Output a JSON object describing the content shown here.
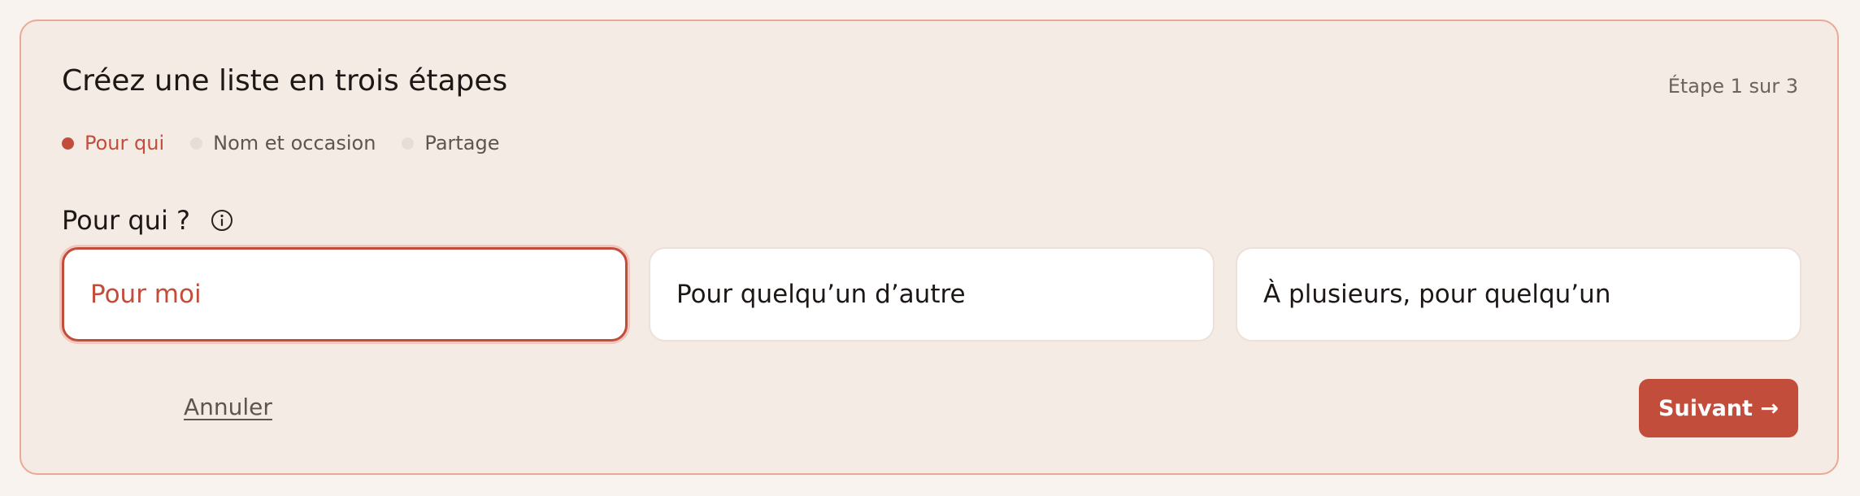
{
  "wizard": {
    "title": "Créez une liste en trois étapes",
    "step_counter": "Étape 1 sur 3",
    "steps": [
      {
        "label": "Pour qui"
      },
      {
        "label": "Nom et occasion"
      },
      {
        "label": "Partage"
      }
    ],
    "question": {
      "label": "Pour qui ?",
      "info_icon": "info-circle-icon"
    },
    "options": [
      {
        "label": "Pour moi"
      },
      {
        "label": "Pour quelqu’un d’autre"
      },
      {
        "label": "À plusieurs, pour quelqu’un"
      }
    ],
    "cancel_label": "Annuler",
    "next_label": "Suivant →"
  },
  "colors": {
    "accent": "#c24d3b",
    "card_background": "#f5ebe5",
    "card_border": "#eaa996",
    "page_background": "#f8f3ee"
  }
}
